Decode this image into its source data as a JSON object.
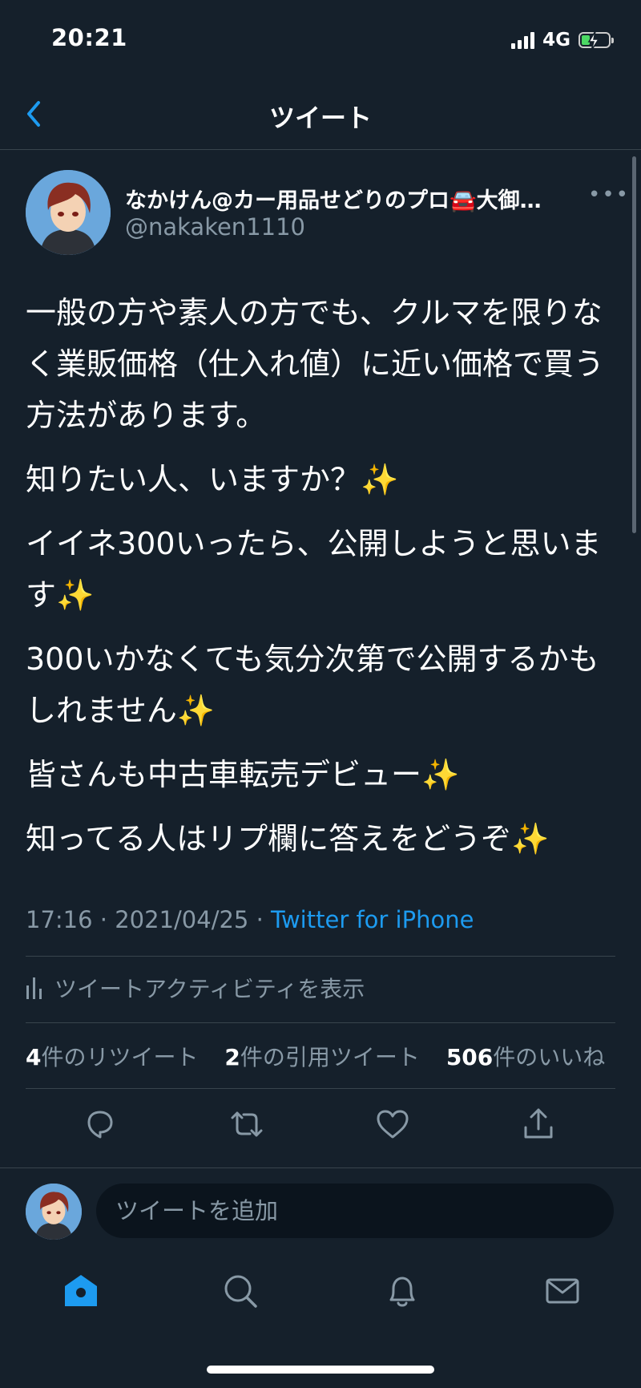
{
  "status_bar": {
    "time": "20:21",
    "network": "4G"
  },
  "header": {
    "title": "ツイート"
  },
  "tweet": {
    "display_name": "なかけん@カー用品せどりのプロ🚘大御…",
    "username": "@nakaken1110",
    "more": "•••",
    "paragraphs": [
      "一般の方や素人の方でも、クルマを限りなく業販価格（仕入れ値）に近い価格で買う方法があります。",
      "知りたい人、いますか？✨",
      "イイネ300いったら、公開しようと思います✨",
      "300いかなくても気分次第で公開するかもしれません✨",
      "皆さんも中古車転売デビュー✨",
      "知ってる人はリプ欄に答えをどうぞ✨"
    ],
    "time": "17:16",
    "date": "2021/04/25",
    "separator": " · ",
    "source": "Twitter for iPhone",
    "activity_label": "ツイートアクティビティを表示",
    "stats": {
      "retweets_count": "4",
      "retweets_label": "件のリツイート",
      "quotes_count": "2",
      "quotes_label": "件の引用ツイート",
      "likes_count": "506",
      "likes_label": "件のいいね"
    }
  },
  "reply": {
    "placeholder": "ツイートを追加"
  },
  "colors": {
    "background": "#15202b",
    "accent": "#1d9bf0",
    "muted": "#8899a6",
    "divider": "#38444d"
  },
  "icons": [
    "back-icon",
    "more-icon",
    "reply-icon",
    "retweet-icon",
    "like-icon",
    "share-icon",
    "activity-icon",
    "home-icon",
    "search-icon",
    "notifications-icon",
    "messages-icon"
  ]
}
